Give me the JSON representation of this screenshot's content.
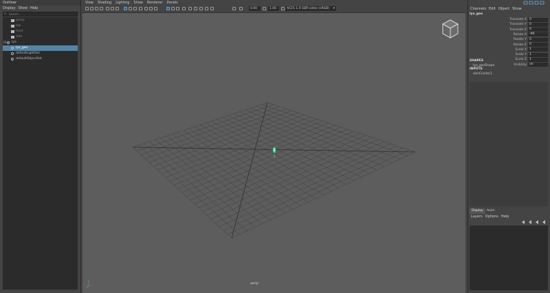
{
  "outliner": {
    "title": "Outliner",
    "menu": [
      "Display",
      "Show",
      "Help"
    ],
    "search_placeholder": "Search...",
    "items": [
      {
        "label": "persp",
        "icon": "camera-icon",
        "dim": true,
        "selected": false,
        "indent": 1
      },
      {
        "label": "top",
        "icon": "camera-icon",
        "dim": true,
        "selected": false,
        "indent": 1
      },
      {
        "label": "front",
        "icon": "camera-icon",
        "dim": true,
        "selected": false,
        "indent": 1
      },
      {
        "label": "side",
        "icon": "camera-icon",
        "dim": true,
        "selected": false,
        "indent": 1
      },
      {
        "label": "lyo",
        "icon": "transform-icon",
        "dim": false,
        "selected": false,
        "indent": 0
      },
      {
        "label": "lyo_geo",
        "icon": "transform-icon",
        "dim": false,
        "selected": true,
        "indent": 1
      },
      {
        "label": "defaultLightSet",
        "icon": "set-icon",
        "dim": false,
        "selected": false,
        "indent": 1
      },
      {
        "label": "defaultObjectSet",
        "icon": "set-icon",
        "dim": false,
        "selected": false,
        "indent": 1
      }
    ]
  },
  "viewport": {
    "menu": [
      "View",
      "Shading",
      "Lighting",
      "Show",
      "Renderer",
      "Panels"
    ],
    "near_clip": "0.00",
    "gamma": "1.00",
    "color_space": "ACES 1.0 SDR-video (sRGB)",
    "camera_label": "persp",
    "colors": {
      "background": "#5d5d5d",
      "grid": "#3f3f3f",
      "selected_green": "#2fe08a"
    }
  },
  "channel_box": {
    "menu": [
      "Channels",
      "Edit",
      "Object",
      "Show"
    ],
    "object_name": "lyo_geo",
    "attributes": [
      {
        "label": "Translate X",
        "value": "0"
      },
      {
        "label": "Translate Y",
        "value": "0"
      },
      {
        "label": "Translate Z",
        "value": "0"
      },
      {
        "label": "Rotate X",
        "value": "-90"
      },
      {
        "label": "Rotate Y",
        "value": "0"
      },
      {
        "label": "Rotate Z",
        "value": "0"
      },
      {
        "label": "Scale X",
        "value": "1"
      },
      {
        "label": "Scale Y",
        "value": "1"
      },
      {
        "label": "Scale Z",
        "value": "1"
      },
      {
        "label": "Visibility",
        "value": "on"
      }
    ],
    "shapes_header": "SHAPES",
    "shape_name": "lyo_geoShape",
    "inputs_header": "INPUTS",
    "input_name": "skinCluster1"
  },
  "layer_editor": {
    "tabs": [
      "Display",
      "Anim"
    ],
    "menu": [
      "Layers",
      "Options",
      "Help"
    ]
  }
}
